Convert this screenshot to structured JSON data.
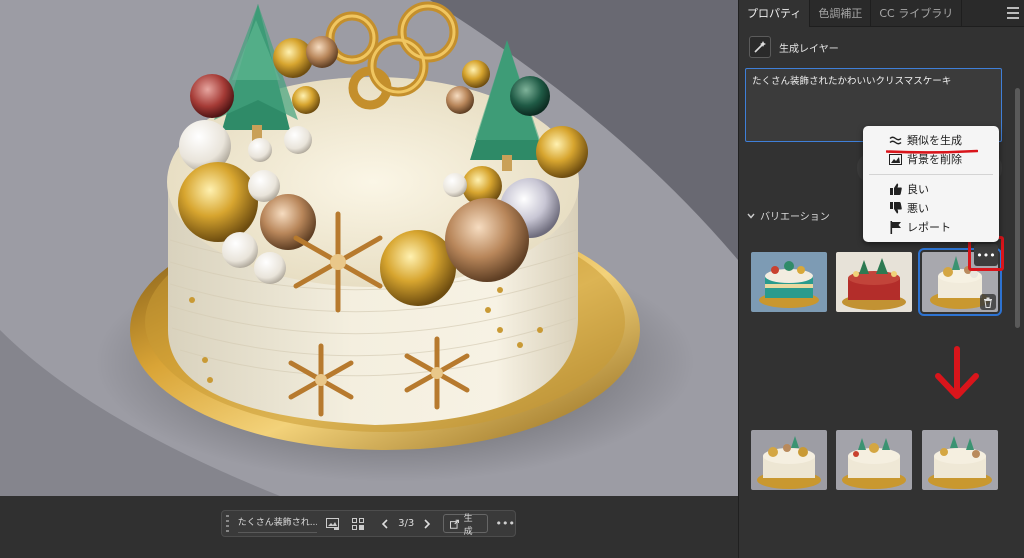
{
  "panel": {
    "tabs": [
      {
        "label": "プロパティ",
        "active": true
      },
      {
        "label": "色調補正",
        "active": false
      },
      {
        "label": "CC ライブラリ",
        "active": false
      }
    ],
    "layer_title": "生成レイヤー",
    "prompt_text": "たくさん装飾されたかわいいクリスマスケーキ",
    "variations_label": "バリエーション"
  },
  "popup_menu": {
    "items": [
      {
        "label": "類似を生成",
        "icon": "approx-icon"
      },
      {
        "label": "背景を削除",
        "icon": "remove-background-icon"
      },
      {
        "label": "良い",
        "icon": "thumbs-up-icon"
      },
      {
        "label": "悪い",
        "icon": "thumbs-down-icon"
      },
      {
        "label": "レポート",
        "icon": "flag-icon"
      }
    ]
  },
  "taskbar": {
    "prompt": "たくさん装飾され...",
    "counter": "3/3",
    "generate_label": "生成"
  },
  "colors": {
    "accent_blue": "#2d73d2",
    "annotation_red": "#d9151b",
    "panel_bg": "#323232"
  }
}
